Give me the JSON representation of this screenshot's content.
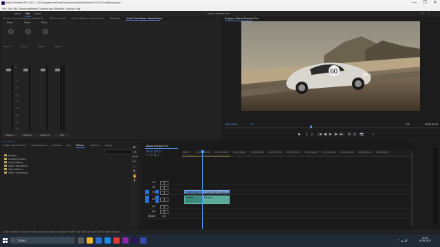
{
  "window": {
    "title": "Adobe Premiere Pro 2022 - C:\\Пользователи\\Лена\\Documents\\Adobe\\Premiere Pro\\22.0\\Untitled.prproj *",
    "controls": [
      "—",
      "❐",
      "✕"
    ]
  },
  "menu": [
    "File",
    "Edit",
    "Clip",
    "Sequence",
    "Markers",
    "Graphics and Titles",
    "View",
    "Window",
    "Help"
  ],
  "workspaces": {
    "items": [
      "Home",
      "Import",
      "Edit",
      "Export"
    ],
    "active": "Edit",
    "right_label": "Mazda Premiere Pro"
  },
  "panel_tabs": [
    "Source: Porsche Premiere Mazda Premiere (no clips)",
    "Effect Controls",
    "Audio Clip Mixer: Mazda Premiere Pro",
    "Metadata",
    "Audio Track Mixer: Mazda Premiere Pro"
  ],
  "mixer": {
    "channels": [
      {
        "knob_label": "Read",
        "name": "Audio 1",
        "value": "0.0"
      },
      {
        "knob_label": "Read",
        "name": "Audio 2",
        "value": "0.0"
      },
      {
        "knob_label": "Read",
        "name": "Audio 3",
        "value": "0.0"
      },
      {
        "knob_label": "Read",
        "name": "Mix",
        "value": "0.0"
      }
    ],
    "scale": [
      "6",
      "0",
      "-6",
      "-12",
      "-18",
      "-24",
      "-30",
      "-36",
      "-42",
      "-48",
      "-54",
      "dB"
    ],
    "playhead_label": "00;01;08;11"
  },
  "program": {
    "title": "Program: Mazda Premiere Pro",
    "timecode_left": "00;01;08;11",
    "fit": "Fit",
    "fraction": "Full",
    "timecode_right": "00;01;41;19",
    "controls": [
      "◆",
      "{",
      "}",
      "|◀",
      "◀|",
      "▶",
      "|▶",
      "▶|",
      "⊞",
      "⊟",
      "📷",
      "+"
    ]
  },
  "effects": {
    "status_label": "00;01;08;11",
    "tabs": [
      "Project: Mazda Premiere Pro",
      "Media Browser",
      "Libraries",
      "Info",
      "Effects",
      "Markers",
      "History"
    ],
    "active_tab": "Effects",
    "items": [
      "Presets",
      "Lumetri Presets",
      "Audio Effects",
      "Audio Transitions",
      "Video Effects",
      "Video Transitions"
    ]
  },
  "timeline": {
    "tab": "Mazda Premiere Pro",
    "timecode": "00;01;08;11",
    "ruler": [
      "00;00",
      "00;00;32;00",
      "00;01;04;02",
      "00;01;36;02",
      "00;02;08;04",
      "00;02;40;04",
      "00;03;12;06",
      "00;03;44;06",
      "00;04;16;08",
      "00;04;48;08",
      "00;05;20;10",
      "00;05;52;10"
    ],
    "tracks": {
      "video": [
        "V3",
        "V2",
        "V1"
      ],
      "audio": [
        "A1",
        "A2",
        "A3"
      ],
      "master": "Master",
      "master_value": "0.0"
    },
    "clips": {
      "v1": [
        "Porsche Sport Classic.mp4",
        "Porsche Sport Classic.mp4 [V]"
      ],
      "a1": [
        "Porsche",
        "Porsche"
      ]
    }
  },
  "statusbar": "Click to select, or click in empty space and drag to marquee select. Use Shift, Alt, and Ctrl for other options.",
  "taskbar": {
    "search_placeholder": "Поиск",
    "time": "12:04",
    "date": "30.05.2022",
    "icon_colors": [
      "#5b5b5b",
      "#f2b632",
      "#2b6fd1",
      "#1e88e5",
      "#e53935",
      "#8e24aa",
      "#2b1a5a",
      "#3949ab"
    ]
  }
}
